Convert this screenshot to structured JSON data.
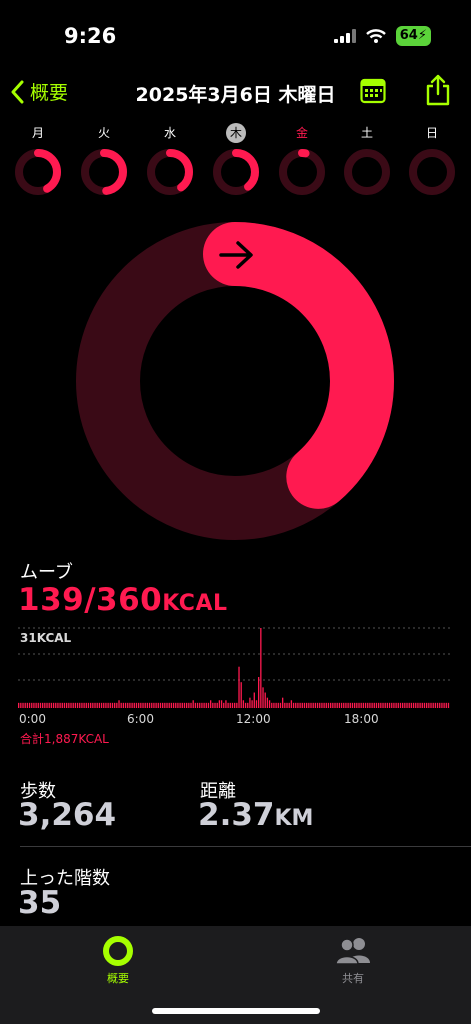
{
  "status": {
    "time": "9:26",
    "battery": "64"
  },
  "nav": {
    "back_label": "概要",
    "title": "2025年3月6日 木曜日"
  },
  "week": {
    "days": [
      "月",
      "火",
      "水",
      "木",
      "金",
      "土",
      "日"
    ],
    "move_progress": [
      0.42,
      0.48,
      0.4,
      0.39,
      0.03,
      0.0,
      0.0
    ],
    "today_index": 3
  },
  "ring": {
    "move_progress": 0.386,
    "color": "#ff1a50",
    "track_color": "#3a0a16"
  },
  "move": {
    "label": "ムーブ",
    "value": "139/360",
    "unit": "KCAL",
    "chart_max_label": "31KCAL",
    "total": "合計1,887KCAL"
  },
  "chart_data": {
    "type": "bar",
    "ylim": [
      0,
      31
    ],
    "x_ticks": [
      "0:00",
      "6:00",
      "12:00",
      "18:00"
    ],
    "values": [
      2,
      2,
      2,
      2,
      2,
      2,
      2,
      2,
      2,
      2,
      2,
      2,
      2,
      2,
      2,
      2,
      2,
      2,
      2,
      2,
      2,
      2,
      2,
      2,
      2,
      2,
      2,
      2,
      2,
      2,
      2,
      2,
      2,
      2,
      2,
      2,
      2,
      2,
      2,
      2,
      2,
      2,
      2,
      2,
      2,
      2,
      3,
      2,
      2,
      2,
      2,
      2,
      2,
      2,
      2,
      2,
      2,
      2,
      2,
      2,
      2,
      2,
      2,
      2,
      2,
      2,
      2,
      2,
      2,
      2,
      2,
      2,
      2,
      2,
      2,
      2,
      2,
      2,
      2,
      2,
      3,
      2,
      2,
      2,
      2,
      2,
      2,
      2,
      3,
      2,
      2,
      2,
      3,
      3,
      2,
      3,
      2,
      2,
      2,
      2,
      2,
      16,
      10,
      3,
      2,
      2,
      4,
      3,
      6,
      3,
      12,
      31,
      8,
      6,
      4,
      3,
      2,
      2,
      2,
      2,
      2,
      4,
      2,
      2,
      2,
      3,
      2,
      2,
      2,
      2,
      2,
      2,
      2,
      2,
      2,
      2,
      2,
      2,
      2,
      2,
      2,
      2,
      2,
      2,
      2,
      2,
      2,
      2,
      2,
      2,
      2,
      2,
      2,
      2,
      2,
      2,
      2,
      2,
      2,
      2,
      2,
      2,
      2,
      2,
      2,
      2,
      2,
      2,
      2,
      2,
      2,
      2,
      2,
      2,
      2,
      2,
      2,
      2,
      2,
      2,
      2,
      2,
      2,
      2,
      2,
      2,
      2,
      2,
      2,
      2,
      2,
      2,
      2,
      2,
      2,
      2,
      2,
      2
    ]
  },
  "stats": {
    "steps_label": "歩数",
    "steps_value": "3,264",
    "distance_label": "距離",
    "distance_value": "2.37",
    "distance_unit": "KM",
    "floors_label": "上った階数",
    "floors_value": "35"
  },
  "tabs": [
    {
      "label": "概要",
      "icon": "activity-ring-icon",
      "active": true
    },
    {
      "label": "共有",
      "icon": "people-icon",
      "active": false
    }
  ]
}
